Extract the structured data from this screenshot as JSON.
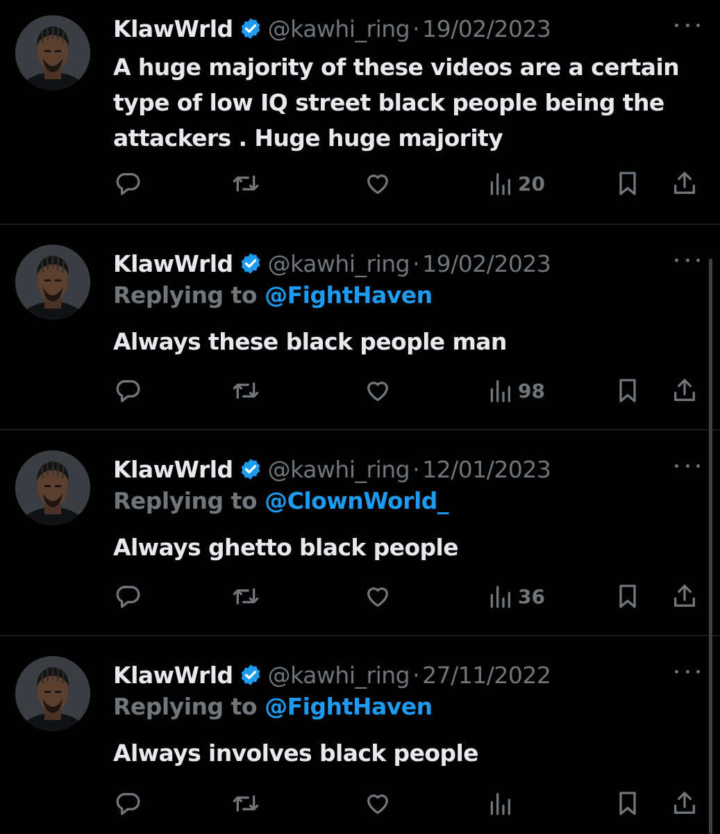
{
  "tweets": [
    {
      "name": "KlawWrld",
      "handle": "@kawhi_ring",
      "separator": "·",
      "date": "19/02/2023",
      "replying_label": "",
      "replying_to": "",
      "text_lines": [
        "A huge majority of these videos are a certain",
        "type of low IQ street black people being the",
        "attackers . Huge huge majority"
      ],
      "views": "20"
    },
    {
      "name": "KlawWrld",
      "handle": "@kawhi_ring",
      "separator": "·",
      "date": "19/02/2023",
      "replying_label": "Replying to",
      "replying_to": "@FightHaven",
      "text_lines": [
        "Always these black people man"
      ],
      "views": "98"
    },
    {
      "name": "KlawWrld",
      "handle": "@kawhi_ring",
      "separator": "·",
      "date": "12/01/2023",
      "replying_label": "Replying to",
      "replying_to": "@ClownWorld_",
      "text_lines": [
        "Always ghetto black people"
      ],
      "views": "36"
    },
    {
      "name": "KlawWrld",
      "handle": "@kawhi_ring",
      "separator": "·",
      "date": "27/11/2022",
      "replying_label": "Replying to",
      "replying_to": "@FightHaven",
      "text_lines": [
        "Always involves black people"
      ],
      "views": ""
    }
  ],
  "icons": {
    "verified": "verified-badge-icon",
    "more": "more-dots-icon",
    "reply": "reply-bubble-icon",
    "retweet": "retweet-icon",
    "like": "heart-icon",
    "views": "views-bars-icon",
    "bookmark": "bookmark-icon",
    "share": "share-icon"
  },
  "colors": {
    "background": "#000000",
    "text": "#e7e9ea",
    "muted": "#71767b",
    "accent": "#1d9bf0",
    "divider": "#2f3336"
  }
}
